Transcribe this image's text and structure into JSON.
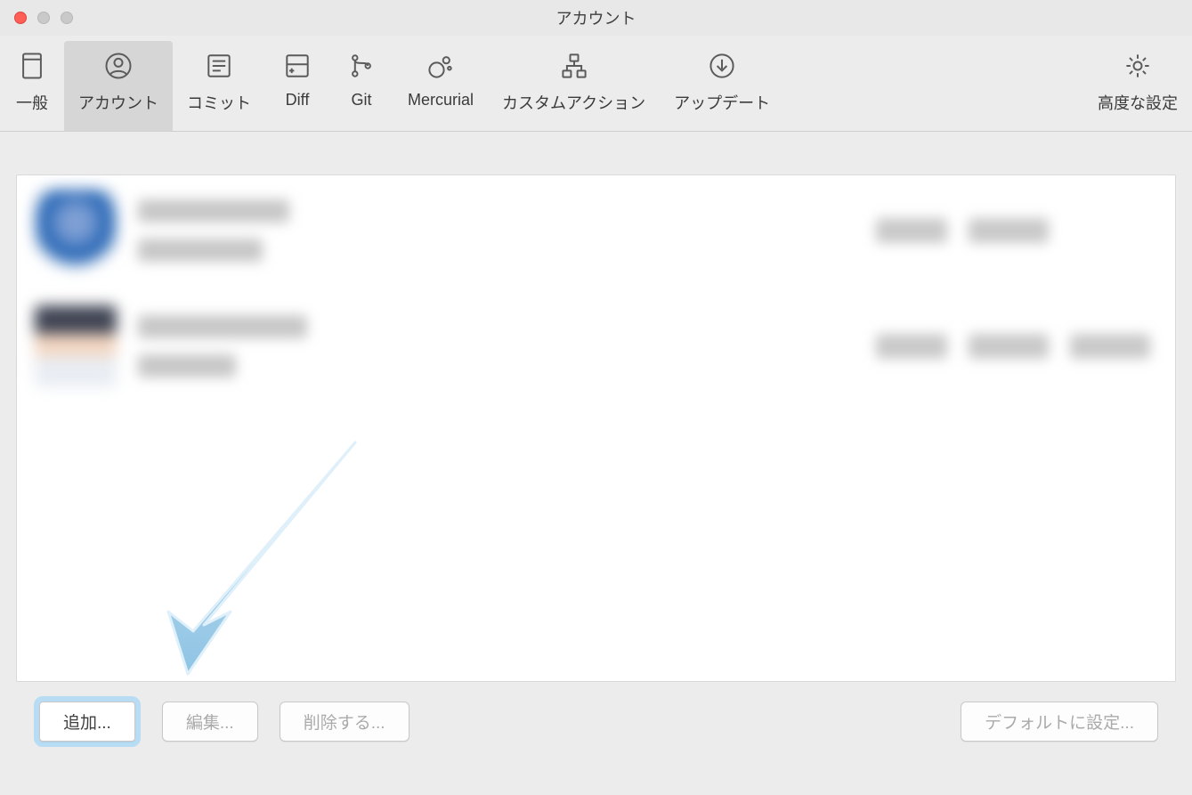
{
  "window": {
    "title": "アカウント"
  },
  "toolbar": {
    "tabs": [
      {
        "id": "general",
        "label": "一般"
      },
      {
        "id": "accounts",
        "label": "アカウント"
      },
      {
        "id": "commit",
        "label": "コミット"
      },
      {
        "id": "diff",
        "label": "Diff"
      },
      {
        "id": "git",
        "label": "Git"
      },
      {
        "id": "mercurial",
        "label": "Mercurial"
      },
      {
        "id": "custom",
        "label": "カスタムアクション"
      },
      {
        "id": "update",
        "label": "アップデート"
      },
      {
        "id": "advanced",
        "label": "高度な設定"
      }
    ],
    "active_tab": "accounts"
  },
  "accounts": [
    {
      "username_redacted": true,
      "service_redacted": true,
      "auth_redacted": true,
      "protocol_redacted": true
    },
    {
      "username_redacted": true,
      "service_redacted": true,
      "auth_redacted": true,
      "protocol_redacted": true,
      "extra_redacted": true
    }
  ],
  "buttons": {
    "add": "追加...",
    "edit": "編集...",
    "delete": "削除する...",
    "set_default": "デフォルトに設定..."
  },
  "annotation": {
    "arrow_points_to": "add-button"
  },
  "colors": {
    "toolbar_bg": "#ececec",
    "tab_active_bg": "#d6d6d6",
    "icon_stroke": "#5b5b5b",
    "highlight_ring": "#b7dcf3",
    "arrow": "#a7d0e8"
  }
}
